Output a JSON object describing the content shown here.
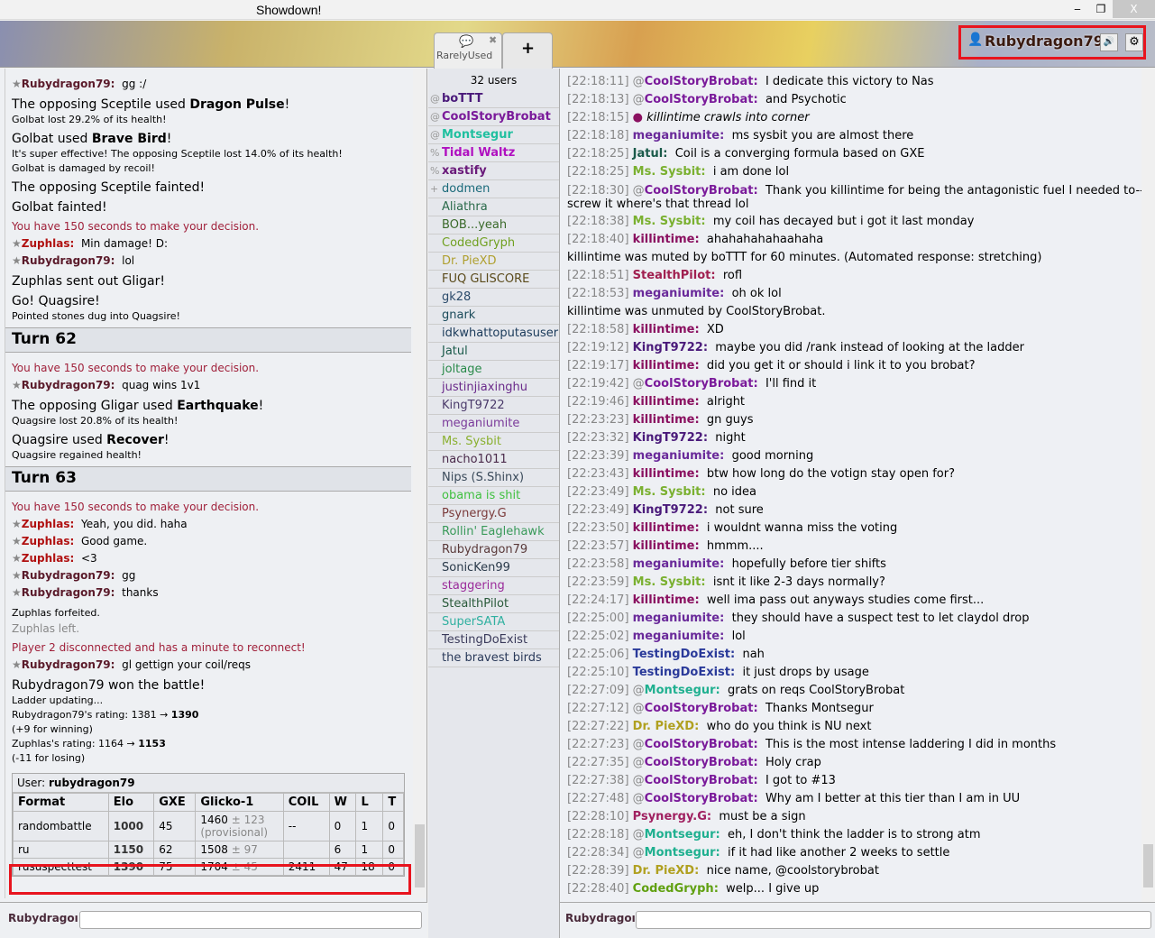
{
  "window": {
    "title": "Showdown!",
    "min": "‒",
    "max": "❐",
    "close": "X"
  },
  "tabs": {
    "room": "RarelyUsed",
    "add": "+"
  },
  "user": {
    "name": "Rubydragon79",
    "sound_icon": "🔊",
    "gear_icon": "⚙"
  },
  "battle_log": [
    {
      "t": "chat",
      "name": "Rubydragon79",
      "color": "#5a1a2a",
      "text": "gg :/"
    },
    {
      "t": "big",
      "html": "The opposing Sceptile used <b>Dragon Pulse</b>!"
    },
    {
      "t": "small",
      "text": "Golbat lost 29.2% of its health!"
    },
    {
      "t": "big",
      "html": "Golbat used <b>Brave Bird</b>!"
    },
    {
      "t": "small",
      "text": "It's super effective! The opposing Sceptile lost 14.0% of its health!"
    },
    {
      "t": "small",
      "text": "Golbat is damaged by recoil!"
    },
    {
      "t": "big",
      "text": "The opposing Sceptile fainted!"
    },
    {
      "t": "big",
      "text": "Golbat fainted!"
    },
    {
      "t": "red",
      "text": "You have 150 seconds to make your decision."
    },
    {
      "t": "chat",
      "name": "Zuphlas",
      "color": "#b01010",
      "text": "Min damage! D:"
    },
    {
      "t": "chat",
      "name": "Rubydragon79",
      "color": "#5a1a2a",
      "text": "lol"
    },
    {
      "t": "big",
      "text": "Zuphlas sent out Gligar!"
    },
    {
      "t": "big",
      "text": "Go! Quagsire!"
    },
    {
      "t": "small",
      "text": "Pointed stones dug into Quagsire!"
    },
    {
      "t": "turn",
      "text": "Turn 62"
    },
    {
      "t": "red",
      "text": "You have 150 seconds to make your decision."
    },
    {
      "t": "chat",
      "name": "Rubydragon79",
      "color": "#5a1a2a",
      "text": "quag wins 1v1"
    },
    {
      "t": "big",
      "html": "The opposing Gligar used <b>Earthquake</b>!"
    },
    {
      "t": "small",
      "text": "Quagsire lost 20.8% of its health!"
    },
    {
      "t": "big",
      "html": "Quagsire used <b>Recover</b>!"
    },
    {
      "t": "small",
      "text": "Quagsire regained health!"
    },
    {
      "t": "turn",
      "text": "Turn 63"
    },
    {
      "t": "red",
      "text": "You have 150 seconds to make your decision."
    },
    {
      "t": "chat",
      "name": "Zuphlas",
      "color": "#b01010",
      "text": "Yeah, you did. haha"
    },
    {
      "t": "chat",
      "name": "Zuphlas",
      "color": "#b01010",
      "text": "Good game."
    },
    {
      "t": "chat",
      "name": "Zuphlas",
      "color": "#b01010",
      "text": "<3"
    },
    {
      "t": "chat",
      "name": "Rubydragon79",
      "color": "#5a1a2a",
      "text": "gg"
    },
    {
      "t": "chat",
      "name": "Rubydragon79",
      "color": "#5a1a2a",
      "text": "thanks"
    },
    {
      "t": "small",
      "text": "Zuphlas forfeited."
    },
    {
      "t": "gray",
      "text": "Zuphlas left."
    },
    {
      "t": "red",
      "text": "Player 2 disconnected and has a minute to reconnect!"
    },
    {
      "t": "chat",
      "name": "Rubydragon79",
      "color": "#5a1a2a",
      "text": "gl gettign your coil/reqs"
    },
    {
      "t": "big",
      "text": "Rubydragon79 won the battle!"
    },
    {
      "t": "small",
      "text": "Ladder updating..."
    },
    {
      "t": "small",
      "html": "Rubydragon79's rating: 1381 → <b>1390</b><br>(+9 for winning)"
    },
    {
      "t": "small",
      "html": "Zuphlas's rating: 1164 → <b>1153</b><br>(-11 for losing)"
    }
  ],
  "ratings": {
    "user_label": "User:",
    "user": "rubydragon79",
    "headers": [
      "Format",
      "Elo",
      "GXE",
      "Glicko-1",
      "COIL",
      "W",
      "L",
      "T"
    ],
    "rows": [
      {
        "format": "randombattle",
        "elo": "1000",
        "gxe": "45",
        "glicko": "1460",
        "dev": "± 123",
        "note": "(provisional)",
        "coil": "--",
        "w": "0",
        "l": "1",
        "t": "0"
      },
      {
        "format": "ru",
        "elo": "1150",
        "gxe": "62",
        "glicko": "1508",
        "dev": "± 97",
        "note": "",
        "coil": "",
        "w": "6",
        "l": "1",
        "t": "0"
      },
      {
        "format": "rususpecttest",
        "elo": "1390",
        "gxe": "75",
        "glicko": "1704",
        "dev": "± 45",
        "note": "",
        "coil": "2411",
        "w": "47",
        "l": "18",
        "t": "0"
      }
    ]
  },
  "userlist": {
    "count": "32 users",
    "users": [
      {
        "g": "@",
        "n": "boTTT",
        "c": "#4a1a7a",
        "b": true
      },
      {
        "g": "@",
        "n": "CoolStoryBrobat",
        "c": "#7a1a9a",
        "b": true
      },
      {
        "g": "@",
        "n": "Montsegur",
        "c": "#20c0a0",
        "b": true
      },
      {
        "g": "%",
        "n": "Tidal Waltz",
        "c": "#b010c0",
        "b": true
      },
      {
        "g": "%",
        "n": "xastify",
        "c": "#6a1a7a",
        "b": true
      },
      {
        "g": "+",
        "n": "dodmen",
        "c": "#1a6a7a"
      },
      {
        "g": "",
        "n": "Aliathra",
        "c": "#2a6a4a"
      },
      {
        "g": "",
        "n": "BOB...yeah",
        "c": "#3a6a2a"
      },
      {
        "g": "",
        "n": "CodedGryph",
        "c": "#70a020"
      },
      {
        "g": "",
        "n": "Dr. PieXD",
        "c": "#b0a030"
      },
      {
        "g": "",
        "n": "FUQ GLISCORE",
        "c": "#5a4a1a"
      },
      {
        "g": "",
        "n": "gk28",
        "c": "#2a4a6a"
      },
      {
        "g": "",
        "n": "gnark",
        "c": "#1a4a5a"
      },
      {
        "g": "",
        "n": "idkwhattoputasuser",
        "c": "#1a3a5a"
      },
      {
        "g": "",
        "n": "Jatul",
        "c": "#1a5a4a"
      },
      {
        "g": "",
        "n": "joltage",
        "c": "#2a8a4a"
      },
      {
        "g": "",
        "n": "justinjiaxinghu",
        "c": "#6a2a8a"
      },
      {
        "g": "",
        "n": "KingT9722",
        "c": "#4a3a6a"
      },
      {
        "g": "",
        "n": "meganiumite",
        "c": "#7a3a9a"
      },
      {
        "g": "",
        "n": "Ms. Sysbit",
        "c": "#8ab030"
      },
      {
        "g": "",
        "n": "nacho1011",
        "c": "#4a2a4a"
      },
      {
        "g": "",
        "n": "Nips (S.Shinx)",
        "c": "#3a4a5a"
      },
      {
        "g": "",
        "n": "obama is shit",
        "c": "#40c040"
      },
      {
        "g": "",
        "n": "Psynergy.G",
        "c": "#7a3a3a"
      },
      {
        "g": "",
        "n": "Rollin' Eaglehawk",
        "c": "#3a9a5a"
      },
      {
        "g": "",
        "n": "Rubydragon79",
        "c": "#5a3a3a"
      },
      {
        "g": "",
        "n": "SonicKen99",
        "c": "#2a3a4a"
      },
      {
        "g": "",
        "n": "staggering",
        "c": "#9a2a9a"
      },
      {
        "g": "",
        "n": "StealthPilot",
        "c": "#2a5a3a"
      },
      {
        "g": "",
        "n": "SuperSATA",
        "c": "#30b0a0"
      },
      {
        "g": "",
        "n": "TestingDoExist",
        "c": "#3a3a5a"
      },
      {
        "g": "",
        "n": "the bravest birds",
        "c": "#2a3a5a"
      }
    ]
  },
  "chat": [
    {
      "ts": "[22:18:11]",
      "at": "@",
      "n": "CoolStoryBrobat",
      "c": "#7a1a9a",
      "m": "I dedicate this victory to Nas"
    },
    {
      "ts": "[22:18:13]",
      "at": "@",
      "n": "CoolStoryBrobat",
      "c": "#7a1a9a",
      "m": "and Psychotic"
    },
    {
      "ts": "[22:18:15]",
      "emote": "killintime crawls into corner",
      "c": "#8a1060"
    },
    {
      "ts": "[22:18:18]",
      "n": "meganiumite",
      "c": "#6a2a9a",
      "m": "ms sysbit you are almost there"
    },
    {
      "ts": "[22:18:25]",
      "n": "Jatul",
      "c": "#1a5a4a",
      "m": "Coil is a converging formula based on GXE"
    },
    {
      "ts": "[22:18:25]",
      "n": "Ms. Sysbit",
      "c": "#7ab030",
      "m": "i am done lol"
    },
    {
      "ts": "[22:18:30]",
      "at": "@",
      "n": "CoolStoryBrobat",
      "c": "#7a1a9a",
      "m": "Thank you killintime for being the antagonistic fuel I needed to--screw it where's that thread lol",
      "wrap": true
    },
    {
      "ts": "[22:18:38]",
      "n": "Ms. Sysbit",
      "c": "#7ab030",
      "m": "my coil has decayed but i got it last monday"
    },
    {
      "ts": "[22:18:40]",
      "n": "killintime",
      "c": "#8a1060",
      "m": "ahahahahahaahaha"
    },
    {
      "sys": "killintime was muted by boTTT for 60 minutes. (Automated response: stretching)"
    },
    {
      "ts": "[22:18:51]",
      "n": "StealthPilot",
      "c": "#a02050",
      "m": "rofl"
    },
    {
      "ts": "[22:18:53]",
      "n": "meganiumite",
      "c": "#6a2a9a",
      "m": "oh ok lol"
    },
    {
      "sys": "killintime was unmuted by CoolStoryBrobat."
    },
    {
      "ts": "[22:18:58]",
      "n": "killintime",
      "c": "#8a1060",
      "m": "XD"
    },
    {
      "ts": "[22:19:12]",
      "n": "KingT9722",
      "c": "#4a1a7a",
      "m": "maybe you did /rank instead of looking at the ladder"
    },
    {
      "ts": "[22:19:17]",
      "n": "killintime",
      "c": "#8a1060",
      "m": "did you get it or should i link it to you brobat?"
    },
    {
      "ts": "[22:19:42]",
      "at": "@",
      "n": "CoolStoryBrobat",
      "c": "#7a1a9a",
      "m": "I'll find it"
    },
    {
      "ts": "[22:19:46]",
      "n": "killintime",
      "c": "#8a1060",
      "m": "alright"
    },
    {
      "ts": "[22:23:23]",
      "n": "killintime",
      "c": "#8a1060",
      "m": "gn guys"
    },
    {
      "ts": "[22:23:32]",
      "n": "KingT9722",
      "c": "#4a1a7a",
      "m": "night"
    },
    {
      "ts": "[22:23:39]",
      "n": "meganiumite",
      "c": "#6a2a9a",
      "m": "good morning"
    },
    {
      "ts": "[22:23:43]",
      "n": "killintime",
      "c": "#8a1060",
      "m": "btw how long do the votign stay open for?"
    },
    {
      "ts": "[22:23:49]",
      "n": "Ms. Sysbit",
      "c": "#7ab030",
      "m": "no idea"
    },
    {
      "ts": "[22:23:49]",
      "n": "KingT9722",
      "c": "#4a1a7a",
      "m": "not sure"
    },
    {
      "ts": "[22:23:50]",
      "n": "killintime",
      "c": "#8a1060",
      "m": "i wouldnt wanna miss the voting"
    },
    {
      "ts": "[22:23:57]",
      "n": "killintime",
      "c": "#8a1060",
      "m": "hmmm...."
    },
    {
      "ts": "[22:23:58]",
      "n": "meganiumite",
      "c": "#6a2a9a",
      "m": "hopefully before tier shifts"
    },
    {
      "ts": "[22:23:59]",
      "n": "Ms. Sysbit",
      "c": "#7ab030",
      "m": "isnt it like 2-3 days normally?"
    },
    {
      "ts": "[22:24:17]",
      "n": "killintime",
      "c": "#8a1060",
      "m": "well ima pass out anyways studies come first..."
    },
    {
      "ts": "[22:25:00]",
      "n": "meganiumite",
      "c": "#6a2a9a",
      "m": "they should have a suspect test to let claydol drop"
    },
    {
      "ts": "[22:25:02]",
      "n": "meganiumite",
      "c": "#6a2a9a",
      "m": "lol"
    },
    {
      "ts": "[22:25:06]",
      "n": "TestingDoExist",
      "c": "#2a3a9a",
      "m": "nah"
    },
    {
      "ts": "[22:25:10]",
      "n": "TestingDoExist",
      "c": "#2a3a9a",
      "m": "it just drops by usage"
    },
    {
      "ts": "[22:27:09]",
      "at": "@",
      "n": "Montsegur",
      "c": "#20b090",
      "m": "grats on reqs CoolStoryBrobat"
    },
    {
      "ts": "[22:27:12]",
      "at": "@",
      "n": "CoolStoryBrobat",
      "c": "#7a1a9a",
      "m": "Thanks Montsegur"
    },
    {
      "ts": "[22:27:22]",
      "n": "Dr. PieXD",
      "c": "#b0a020",
      "m": "who do you think is NU next"
    },
    {
      "ts": "[22:27:23]",
      "at": "@",
      "n": "CoolStoryBrobat",
      "c": "#7a1a9a",
      "m": "This is the most intense laddering I did in months"
    },
    {
      "ts": "[22:27:35]",
      "at": "@",
      "n": "CoolStoryBrobat",
      "c": "#7a1a9a",
      "m": "Holy crap"
    },
    {
      "ts": "[22:27:38]",
      "at": "@",
      "n": "CoolStoryBrobat",
      "c": "#7a1a9a",
      "m": "I got to #13"
    },
    {
      "ts": "[22:27:48]",
      "at": "@",
      "n": "CoolStoryBrobat",
      "c": "#7a1a9a",
      "m": "Why am I better at this tier than I am in UU"
    },
    {
      "ts": "[22:28:10]",
      "n": "Psynergy.G",
      "c": "#a02060",
      "m": "must be a sign"
    },
    {
      "ts": "[22:28:18]",
      "at": "@",
      "n": "Montsegur",
      "c": "#20b090",
      "m": "eh, I don't think the ladder is to strong atm"
    },
    {
      "ts": "[22:28:34]",
      "at": "@",
      "n": "Montsegur",
      "c": "#20b090",
      "m": "if it had like another 2 weeks to settle"
    },
    {
      "ts": "[22:28:39]",
      "n": "Dr. PieXD",
      "c": "#b0a020",
      "m": "nice name, @coolstorybrobat"
    },
    {
      "ts": "[22:28:40]",
      "n": "CodedGryph",
      "c": "#60a010",
      "m": "welp... I give up"
    }
  ],
  "inputs": {
    "battle_name": "Rubydragoı",
    "chat_name": "Rubydragoı"
  }
}
